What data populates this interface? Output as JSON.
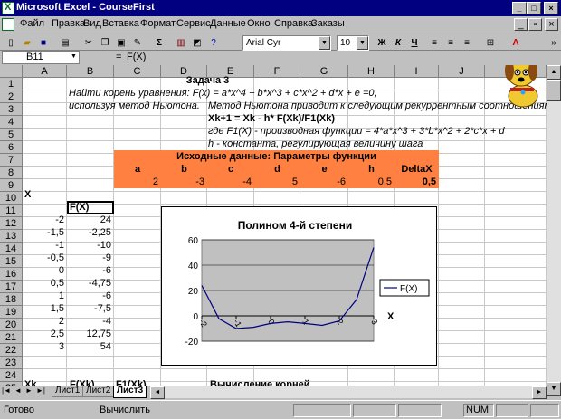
{
  "window": {
    "title": "Microsoft Excel - CourseFirst"
  },
  "menu": [
    "Файл",
    "Правка",
    "Вид",
    "Вставка",
    "Формат",
    "Сервис",
    "Данные",
    "Окно",
    "Справка",
    "Заказы"
  ],
  "toolbar": {
    "font": "Arial Cyr",
    "size": "10",
    "sigma": "Σ",
    "bold": "Ж",
    "italic": "К",
    "underline": "Ч"
  },
  "formula": {
    "namebox": "B11",
    "eq": "=",
    "content": "F(X)"
  },
  "columns": [
    "A",
    "B",
    "C",
    "D",
    "E",
    "F",
    "G",
    "H",
    "I",
    "J"
  ],
  "rows": [
    "1",
    "2",
    "3",
    "4",
    "5",
    "6",
    "7",
    "8",
    "9",
    "10",
    "11",
    "12",
    "13",
    "14",
    "15",
    "16",
    "17",
    "18",
    "19",
    "20",
    "21",
    "22",
    "23",
    "24",
    "25"
  ],
  "sheet": {
    "task_title": "Задача 3",
    "task_line1": "Найти корень уравнения: F(x) = a*x^4 + b*x^3 + c*x^2 + d*x + e =0,",
    "task_line2": "используя метод Ньютона.",
    "method_note": "Метод Ньютона приводит к следующим рекуррентным соотношениям:",
    "newton_formula": "Xk+1 = Xk - h* F(Xk)/F1(Xk)",
    "deriv_note": "где F1(X) - производная функции = 4*a*x^3 + 3*b*x^2 + 2*c*x + d",
    "h_note": "h - константа, регулирующая величину шага",
    "params_header": "Исходные данные: Параметры функции",
    "param_names": [
      "a",
      "b",
      "c",
      "d",
      "e",
      "h",
      "DeltaX"
    ],
    "param_values": [
      "2",
      "-3",
      "-4",
      "5",
      "-6",
      "0,5",
      "0,5"
    ],
    "x_label": "X",
    "fx_label": "F(X)",
    "x_values": [
      "-2",
      "-1,5",
      "-1",
      "-0,5",
      "0",
      "0,5",
      "1",
      "1,5",
      "2",
      "2,5",
      "3"
    ],
    "fx_values": [
      "24",
      "-2,25",
      "-10",
      "-9",
      "-6",
      "-4,75",
      "-6",
      "-7,5",
      "-4",
      "12,75",
      "54"
    ],
    "xk_label": "Xk",
    "fxk_label": "F(Xk)",
    "f1xk_label": "F1(Xk)",
    "roots_label": "Вычисление корней"
  },
  "tabs": [
    "Лист1",
    "Лист2",
    "Лист3"
  ],
  "status": {
    "ready": "Готово",
    "mode": "Вычислить",
    "num": "NUM"
  },
  "chart_data": {
    "type": "line",
    "title": "Полином 4-й степени",
    "categories": [
      "-2",
      "-1,5",
      "-1",
      "-0,5",
      "0",
      "0,5",
      "1",
      "1,5",
      "2",
      "2,5",
      "3"
    ],
    "x_ticks": [
      "-2",
      "-1",
      "0",
      "1",
      "2",
      "3"
    ],
    "series": [
      {
        "name": "F(X)",
        "values": [
          24,
          -2.25,
          -10,
          -9,
          -6,
          -4.75,
          -6,
          -7.5,
          -4,
          12.75,
          54
        ]
      }
    ],
    "xlabel": "X",
    "ylim": [
      -20,
      60
    ],
    "yticks": [
      "60",
      "40",
      "20",
      "0",
      "-20"
    ],
    "legend": "right",
    "plot_color": "#c0c0c0",
    "line_color": "#000080"
  }
}
